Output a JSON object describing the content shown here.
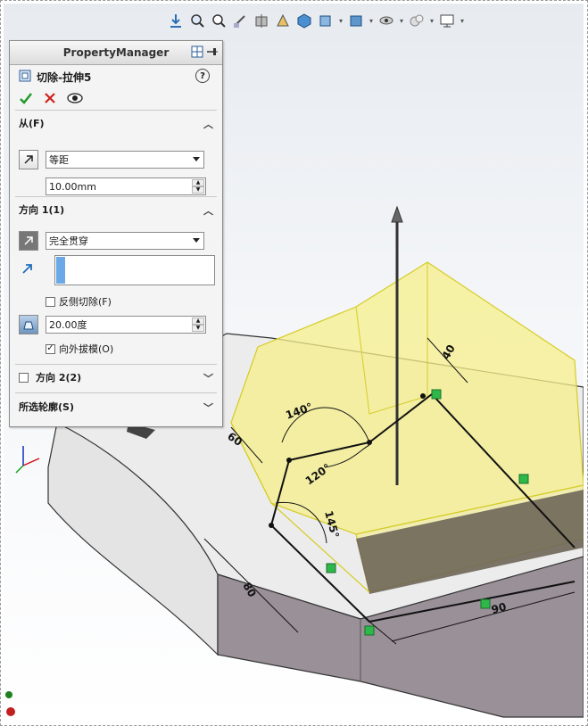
{
  "property_manager": {
    "header_title": "PropertyManager",
    "feature_title": "切除-拉伸5",
    "help_label": "?",
    "from_section": {
      "title": "从(F)",
      "condition": "等距",
      "offset_value": "10.00mm"
    },
    "direction1_section": {
      "title": "方向 1(1)",
      "end_condition": "完全贯穿",
      "flip_side_label": "反侧切除(F)",
      "flip_side_checked": false,
      "draft_value": "20.00度",
      "draft_outward_label": "向外拔模(O)",
      "draft_outward_checked": true
    },
    "direction2_section": {
      "title": "方向 2(2)",
      "checked": false
    },
    "selected_contours_section": {
      "title": "所选轮廓(S)"
    }
  },
  "sketch_dimensions": {
    "d40": "40",
    "d140": "140°",
    "d60": "60",
    "d120": "120°",
    "d145": "145°",
    "d80": "80",
    "d90": "90"
  },
  "toolbar_icons": [
    "view-orient-icon",
    "zoom-fit-icon",
    "zoom-area-icon",
    "previous-view-icon",
    "section-view-icon",
    "dynamic-annotation-icon",
    "view-cube-icon",
    "display-style-icon",
    "hide-show-icon",
    "appearance-icon",
    "scene-icon",
    "monitor-icon"
  ],
  "colors": {
    "preview_fill": "#f5ef8a",
    "preview_edge": "#d6cc28",
    "sketch_line": "#111111",
    "relation_marker": "#2fb84a",
    "annotation_red": "#e0201c",
    "cut_face": "#6e6658"
  }
}
